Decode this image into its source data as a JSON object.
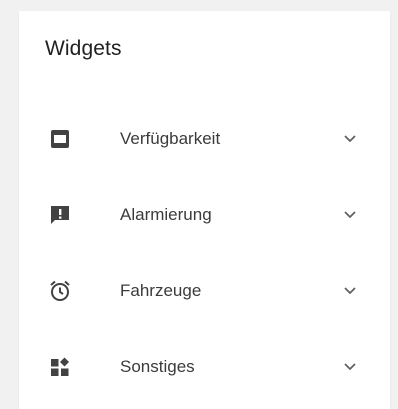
{
  "panel": {
    "title": "Widgets"
  },
  "menu": {
    "items": [
      {
        "label": "Verfügbarkeit",
        "icon": "availability-icon"
      },
      {
        "label": "Alarmierung",
        "icon": "alarm-message-icon"
      },
      {
        "label": "Fahrzeuge",
        "icon": "alarm-clock-icon"
      },
      {
        "label": "Sonstiges",
        "icon": "widgets-icon"
      }
    ]
  },
  "colors": {
    "icon": "#424242",
    "chevron": "#616161",
    "text": "#3b3b3b",
    "title": "#212121"
  }
}
